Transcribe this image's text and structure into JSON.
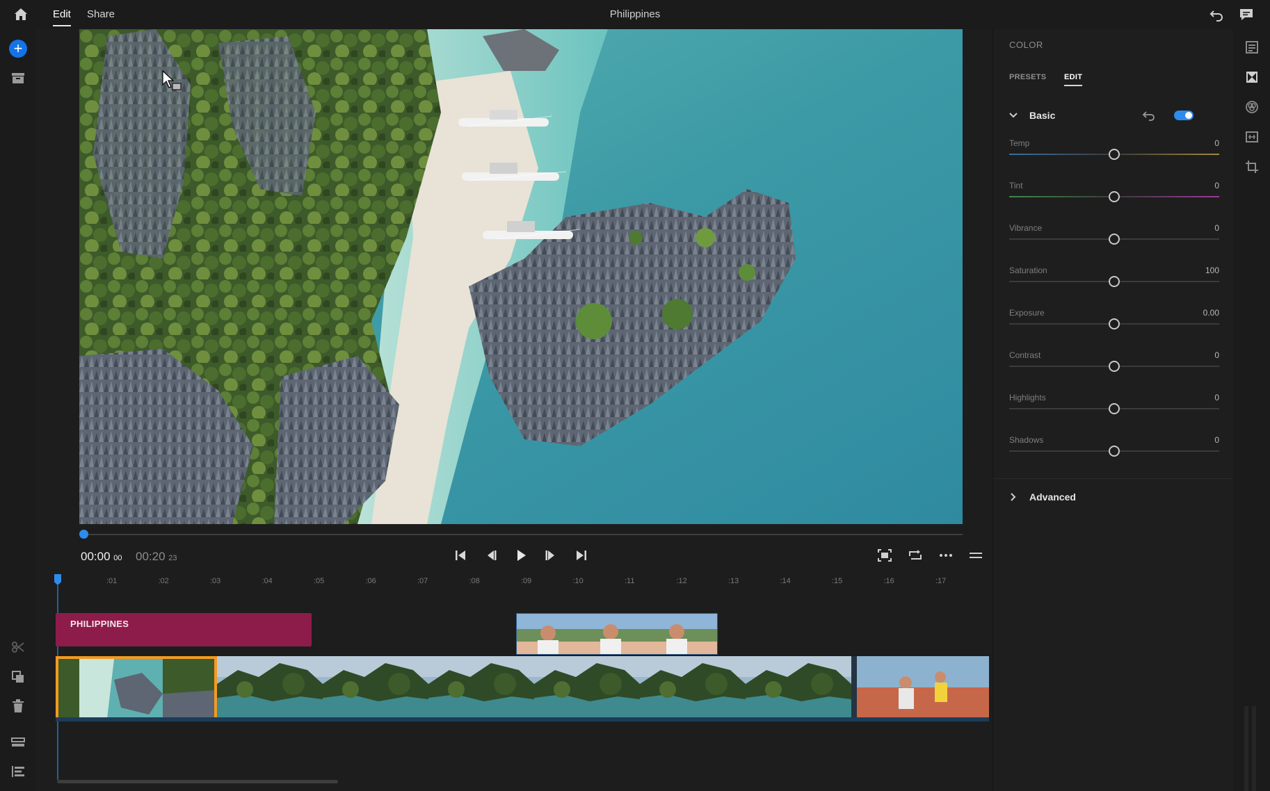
{
  "topbar": {
    "tabs": [
      "Edit",
      "Share"
    ],
    "title": "Philippines"
  },
  "viewer": {
    "current_time": "00:00",
    "current_frames": "00",
    "total_time": "00:20",
    "total_frames": "23",
    "playhead_progress": 0.0
  },
  "timeline": {
    "ruler_labels": [
      ":01",
      ":02",
      ":03",
      ":04",
      ":05",
      ":06",
      ":07",
      ":08",
      ":09",
      ":10",
      ":11",
      ":12",
      ":13",
      ":14",
      ":15",
      ":16",
      ":17"
    ],
    "title_clip_text": "PHILIPPINES"
  },
  "color_panel": {
    "title": "COLOR",
    "tabs": [
      "PRESETS",
      "EDIT"
    ],
    "active_tab": "EDIT",
    "basic_label": "Basic",
    "basic_enabled": true,
    "advanced_label": "Advanced",
    "sliders": [
      {
        "label": "Temp",
        "value": "0",
        "position": 0.5
      },
      {
        "label": "Tint",
        "value": "0",
        "position": 0.5
      },
      {
        "label": "Vibrance",
        "value": "0",
        "position": 0.5
      },
      {
        "label": "Saturation",
        "value": "100",
        "position": 0.5
      },
      {
        "label": "Exposure",
        "value": "0.00",
        "position": 0.5
      },
      {
        "label": "Contrast",
        "value": "0",
        "position": 0.5
      },
      {
        "label": "Highlights",
        "value": "0",
        "position": 0.5
      },
      {
        "label": "Shadows",
        "value": "0",
        "position": 0.5
      }
    ]
  },
  "colors": {
    "accent": "#2d8ceb",
    "title_clip": "#8e1c4a",
    "selected_clip": "#f39a21",
    "add_button": "#1473e6"
  },
  "icons": {
    "top_left": "home-icon",
    "top_right": [
      "undo-icon",
      "comment-icon"
    ],
    "left_rail": [
      "add-media-icon",
      "media-bin-icon",
      "split-icon",
      "duplicate-icon",
      "delete-icon",
      "track-icon",
      "layers-icon"
    ],
    "right_rail": [
      "properties-icon",
      "transitions-icon",
      "color-icon",
      "audio-icon",
      "crop-icon"
    ],
    "transport": [
      "skip-start-icon",
      "step-back-icon",
      "play-icon",
      "step-forward-icon",
      "skip-end-icon"
    ],
    "viewer_tools": [
      "fit-icon",
      "loop-icon",
      "more-icon",
      "menu-icon"
    ]
  }
}
